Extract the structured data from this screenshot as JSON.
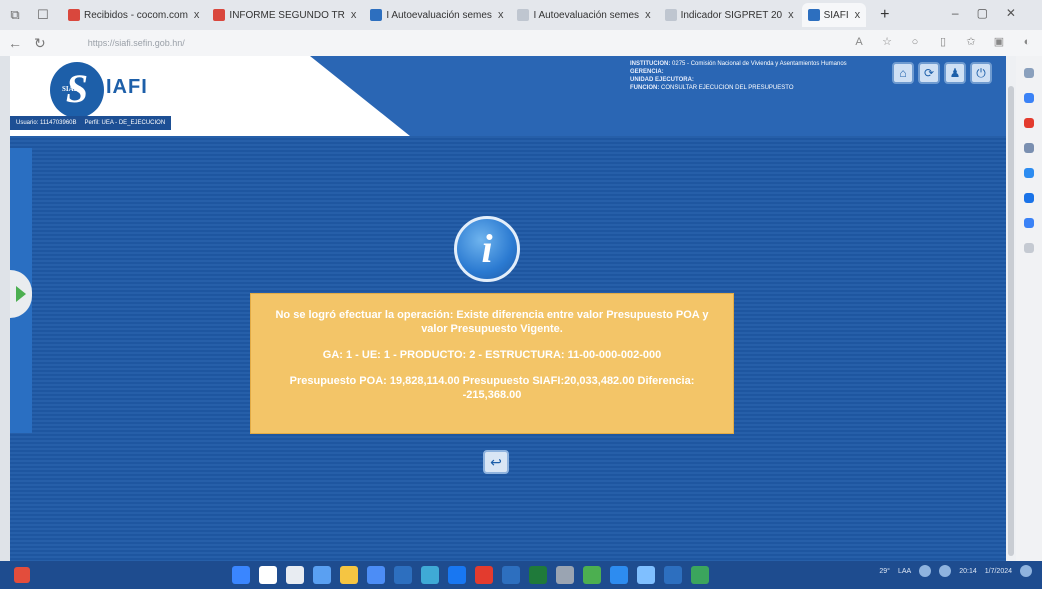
{
  "browser": {
    "tabs": [
      {
        "label": "Recibidos - cocom.com",
        "color": "#d9473d"
      },
      {
        "label": "INFORME SEGUNDO TR",
        "color": "#d9473d"
      },
      {
        "label": "I Autoevaluación semes",
        "color": "#2d6fbf"
      },
      {
        "label": "I Autoevaluación semes",
        "color": "#2d6fbf"
      },
      {
        "label": "Indicador SIGPRET 20",
        "color": "#bfc6d0"
      },
      {
        "label": "SIAFI",
        "color": "#2d6fbf"
      }
    ],
    "close_glyph": "x",
    "new_tab_glyph": "+",
    "url": "https://siafi.sefin.gob.hn/"
  },
  "app": {
    "logo_letter": "S",
    "logo_sub": "SIAFI",
    "logo_text": "IAFI",
    "userbar": {
      "user": "Usuario: 1114703960B",
      "profile": "Perfil: UEA - DE_EJECUCION"
    },
    "header_info": {
      "institucion_label": "INSTITUCIÓN:",
      "institucion_value": "0275 - Comisión Nacional de Vivienda y Asentamientos Humanos",
      "gerencia_label": "GERENCIA:",
      "gerencia_value": "",
      "unidad_label": "UNIDAD EJECUTORA:",
      "unidad_value": "",
      "funcion_label": "FUNCIÓN:",
      "funcion_value": "CONSULTAR EJECUCIÓN DEL PRESUPUESTO"
    },
    "header_buttons": [
      {
        "name": "home-icon",
        "glyph": "⌂"
      },
      {
        "name": "refresh-icon",
        "glyph": "⟳"
      },
      {
        "name": "user-icon",
        "glyph": "♟"
      },
      {
        "name": "power-icon",
        "glyph": "⏻"
      }
    ],
    "info_glyph": "i",
    "message": {
      "line1": "No se logró efectuar la operación: Existe diferencia entre valor Presupuesto POA y valor Presupuesto Vigente.",
      "line2": "GA: 1 - UE: 1 - PRODUCTO: 2 - ESTRUCTURA: 11-00-000-002-000",
      "line3": "Presupuesto POA: 19,828,114.00 Presupuesto SIAFI:20,033,482.00 Diferencia: -215,368.00"
    },
    "ok_glyph": "↩"
  },
  "taskbar": {
    "apps": [
      "#3a86ff",
      "#ffffff",
      "#e8ecf2",
      "#5aa0f2",
      "#f5c542",
      "#4c8df6",
      "#2d6fbf",
      "#3faad6",
      "#1877f2",
      "#e33b2e",
      "#2d6fbf",
      "#1f7a3a",
      "#9aa4b2",
      "#4caf50",
      "#2d8cf0",
      "#7fbfff",
      "#2d6fbf",
      "#3ba55d"
    ],
    "weather": "29°",
    "language": "LAA",
    "time": "20:14",
    "date": "1/7/2024"
  },
  "colors": {
    "app_bg": "#1f5aa6",
    "message_bg": "#f3c568",
    "brand": "#1d5fa9"
  }
}
